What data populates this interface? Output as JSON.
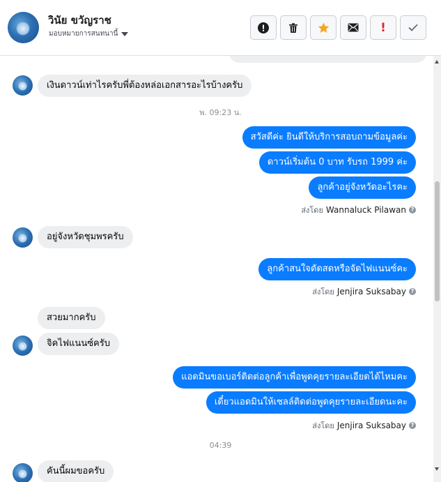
{
  "header": {
    "contact_name": "วินัย ขวัญราช",
    "assign_label": "มอบหมายการสนทนานี้",
    "toolbar": {
      "move_to_spam_icon": "alert-circle-icon",
      "delete_icon": "trash-icon",
      "star_icon": "star-icon",
      "mark_unread_icon": "envelope-icon",
      "follow_up_label": "!",
      "done_icon": "check-icon"
    }
  },
  "messages": [
    {
      "type": "incoming",
      "text": "เงินดาวน์เท่าไรครับพี่ต้องหล่อเอกสารอะไรบ้างครับ"
    },
    {
      "type": "time",
      "text": "พ. 09:23 น."
    },
    {
      "type": "outgoing",
      "text": "สวัสดีค่ะ  ยินดีให้บริการสอบถามข้อมูลค่ะ"
    },
    {
      "type": "outgoing",
      "text": "ดาวน์เริ่มต้น 0 บาท รับรถ 1999 ค่ะ"
    },
    {
      "type": "outgoing",
      "text": "ลูกค้าอยู่จังหวัดอะไรคะ"
    },
    {
      "type": "sentby",
      "prefix": "ส่งโดย",
      "agent": "Wannaluck Pilawan"
    },
    {
      "type": "incoming",
      "text": "อยู่จังหวัดชุมพรครับ"
    },
    {
      "type": "outgoing",
      "text": "ลูกค้าสนใจตัดสดหรือจัดไฟแนนซ์คะ"
    },
    {
      "type": "sentby",
      "prefix": "ส่งโดย",
      "agent": "Jenjira Suksabay"
    },
    {
      "type": "incoming",
      "text": "สวยมากครับ"
    },
    {
      "type": "incoming",
      "text": "จิคไฟแนนซ์ครับ"
    },
    {
      "type": "outgoing",
      "text": "แอดมินขอเบอร์ติดต่อลูกค้าเพื่อพูดคุยรายละเอียดได้ไหมคะ"
    },
    {
      "type": "outgoing",
      "text": "เดี๋ยวแอดมินให้เซลล์ติดต่อพูดคุยรายละเอียดนะคะ"
    },
    {
      "type": "sentby",
      "prefix": "ส่งโดย",
      "agent": "Jenjira Suksabay"
    },
    {
      "type": "time",
      "text": "04:39"
    },
    {
      "type": "incoming",
      "text": "คันนี้ผมขอครับ"
    }
  ],
  "colors": {
    "outgoing_bubble": "#0a7cff",
    "incoming_bubble": "#eceef0",
    "star": "#f5a623",
    "follow_up": "#e02424"
  }
}
